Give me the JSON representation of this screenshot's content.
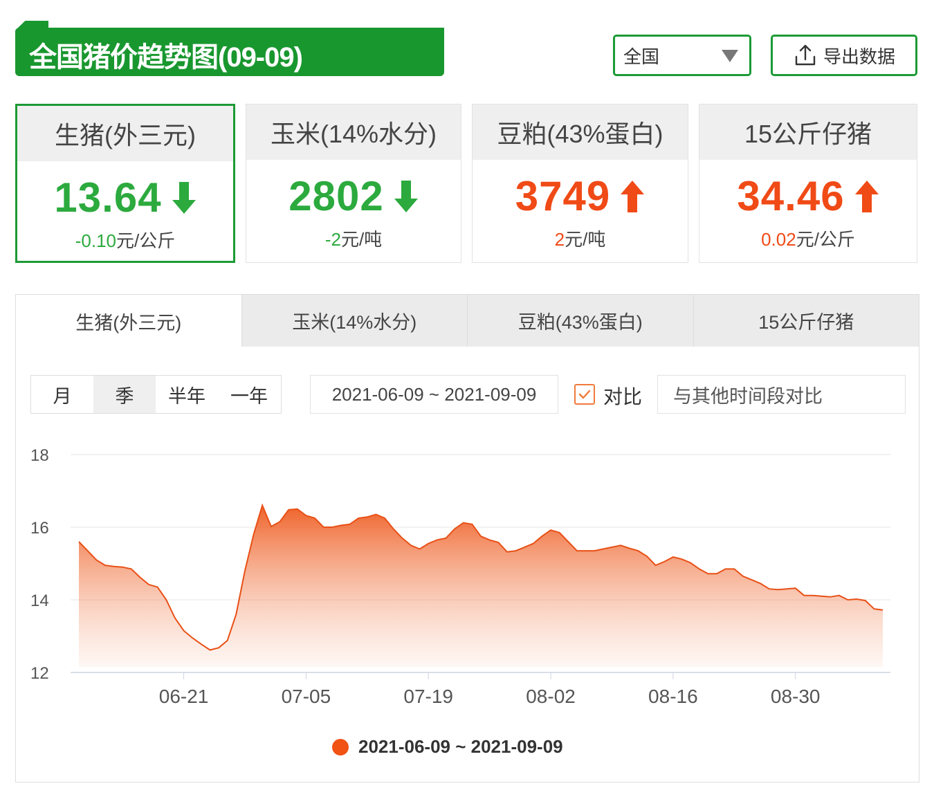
{
  "header": {
    "title": "全国猪价趋势图(09-09)",
    "region_select": "全国",
    "export_label": "导出数据"
  },
  "cards": [
    {
      "label": "生猪(外三元)",
      "value": "13.64",
      "direction": "down",
      "change": "-0.10",
      "unit": "元/公斤"
    },
    {
      "label": "玉米(14%水分)",
      "value": "2802",
      "direction": "down",
      "change": "-2",
      "unit": "元/吨"
    },
    {
      "label": "豆粕(43%蛋白)",
      "value": "3749",
      "direction": "up",
      "change": "2",
      "unit": "元/吨"
    },
    {
      "label": "15公斤仔猪",
      "value": "34.46",
      "direction": "up",
      "change": "0.02",
      "unit": "元/公斤"
    }
  ],
  "tabs": [
    "生猪(外三元)",
    "玉米(14%水分)",
    "豆粕(43%蛋白)",
    "15公斤仔猪"
  ],
  "controls": {
    "periods": [
      "月",
      "季",
      "半年",
      "一年"
    ],
    "active_period": "季",
    "date_range": "2021-06-09 ~ 2021-09-09",
    "compare_label": "对比",
    "compare_checked": true,
    "compare_placeholder": "与其他时间段对比"
  },
  "colors": {
    "brand_green": "#19972f",
    "down_green": "#2caa3e",
    "up_red": "#f04a16",
    "series_orange": "#f05314"
  },
  "chart_data": {
    "type": "area",
    "title": "",
    "xlabel": "",
    "ylabel": "",
    "ylim": [
      12,
      18
    ],
    "yticks": [
      12,
      14,
      16,
      18
    ],
    "xticks": [
      "06-21",
      "07-05",
      "07-19",
      "08-02",
      "08-16",
      "08-30"
    ],
    "grid": true,
    "legend": "bottom",
    "series": [
      {
        "name": "2021-06-09 ~ 2021-09-09",
        "x": [
          "06-09",
          "06-10",
          "06-11",
          "06-12",
          "06-13",
          "06-14",
          "06-15",
          "06-16",
          "06-17",
          "06-18",
          "06-19",
          "06-20",
          "06-21",
          "06-22",
          "06-23",
          "06-24",
          "06-25",
          "06-26",
          "06-27",
          "06-28",
          "06-29",
          "06-30",
          "07-01",
          "07-02",
          "07-03",
          "07-04",
          "07-05",
          "07-06",
          "07-07",
          "07-08",
          "07-09",
          "07-10",
          "07-11",
          "07-12",
          "07-13",
          "07-14",
          "07-15",
          "07-16",
          "07-17",
          "07-18",
          "07-19",
          "07-20",
          "07-21",
          "07-22",
          "07-23",
          "07-24",
          "07-25",
          "07-26",
          "07-27",
          "07-28",
          "07-29",
          "07-30",
          "07-31",
          "08-01",
          "08-02",
          "08-03",
          "08-04",
          "08-05",
          "08-06",
          "08-07",
          "08-08",
          "08-09",
          "08-10",
          "08-11",
          "08-12",
          "08-13",
          "08-14",
          "08-15",
          "08-16",
          "08-17",
          "08-18",
          "08-19",
          "08-20",
          "08-21",
          "08-22",
          "08-23",
          "08-24",
          "08-25",
          "08-26",
          "08-27",
          "08-28",
          "08-29",
          "08-30",
          "08-31",
          "09-01",
          "09-02",
          "09-03",
          "09-04",
          "09-05",
          "09-06",
          "09-07",
          "09-08",
          "09-09"
        ],
        "y": [
          15.6,
          15.35,
          15.1,
          14.95,
          14.92,
          14.9,
          14.85,
          14.62,
          14.42,
          14.35,
          14.0,
          13.5,
          13.15,
          12.95,
          12.78,
          12.62,
          12.68,
          12.88,
          13.6,
          14.8,
          15.8,
          16.6,
          16.02,
          16.15,
          16.48,
          16.5,
          16.32,
          16.25,
          16.0,
          16.0,
          16.05,
          16.08,
          16.25,
          16.28,
          16.35,
          16.25,
          15.95,
          15.7,
          15.5,
          15.4,
          15.55,
          15.65,
          15.7,
          15.95,
          16.12,
          16.08,
          15.75,
          15.65,
          15.58,
          15.32,
          15.35,
          15.45,
          15.55,
          15.75,
          15.92,
          15.85,
          15.6,
          15.35,
          15.35,
          15.35,
          15.4,
          15.45,
          15.5,
          15.42,
          15.35,
          15.2,
          14.95,
          15.05,
          15.18,
          15.12,
          15.02,
          14.85,
          14.72,
          14.72,
          14.85,
          14.85,
          14.65,
          14.55,
          14.45,
          14.3,
          14.28,
          14.3,
          14.32,
          14.12,
          14.12,
          14.1,
          14.08,
          14.12,
          14.0,
          14.02,
          13.98,
          13.75,
          13.72
        ]
      }
    ]
  }
}
